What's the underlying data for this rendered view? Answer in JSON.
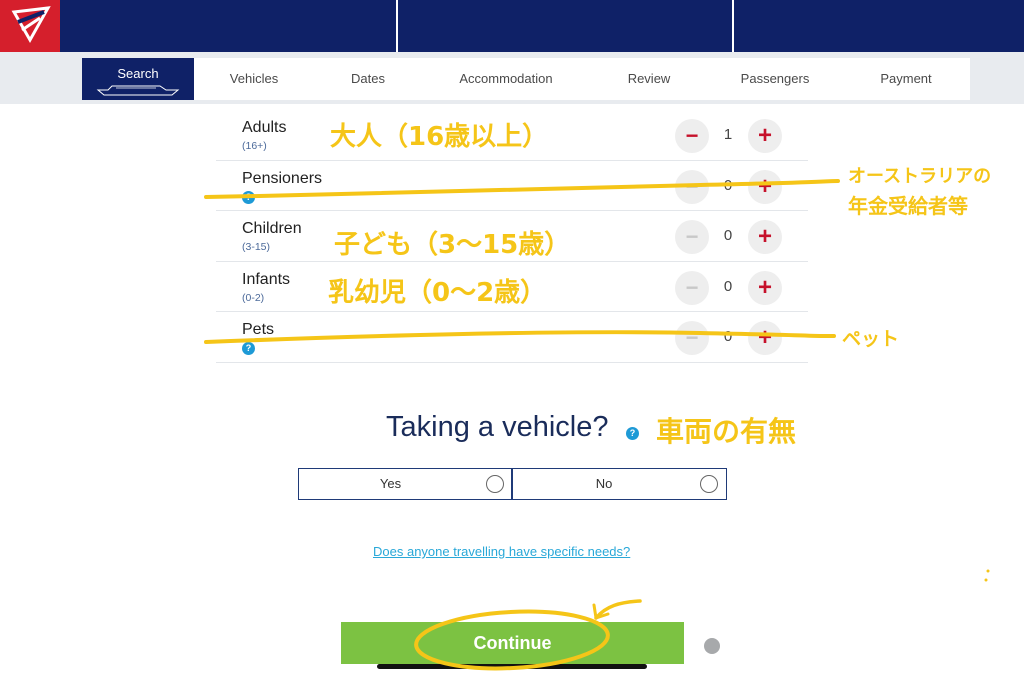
{
  "steps": {
    "search": "Search",
    "vehicles": "Vehicles",
    "dates": "Dates",
    "accommodation": "Accommodation",
    "review": "Review",
    "passengers": "Passengers",
    "payment": "Payment"
  },
  "passengers": {
    "adults": {
      "label": "Adults",
      "sub": "(16+)",
      "count": "1",
      "minus": "−",
      "plus": "+"
    },
    "pensioners": {
      "label": "Pensioners",
      "help": "?",
      "count": "0",
      "minus": "−",
      "plus": "+"
    },
    "children": {
      "label": "Children",
      "sub": "(3-15)",
      "count": "0",
      "minus": "−",
      "plus": "+"
    },
    "infants": {
      "label": "Infants",
      "sub": "(0-2)",
      "count": "0",
      "minus": "−",
      "plus": "+"
    },
    "pets": {
      "label": "Pets",
      "help": "?",
      "count": "0",
      "minus": "−",
      "plus": "+"
    }
  },
  "vehicle": {
    "title": "Taking a vehicle?",
    "help": "?",
    "yes": "Yes",
    "no": "No"
  },
  "needs_link": "Does anyone travelling have specific needs?",
  "continue_label": "Continue",
  "annotations": {
    "adults": "大人（16歳以上）",
    "pensioners_1": "オーストラリアの",
    "pensioners_2": "年金受給者等",
    "children": "子ども（3〜15歳）",
    "infants": "乳幼児（0〜2歳）",
    "pets": "ペット",
    "vehicle": "車両の有無"
  },
  "colors": {
    "navy": "#0f2167",
    "brand_red": "#d51f2c",
    "plus_red": "#c6112b",
    "continue_green": "#7cc242",
    "link_blue": "#29a8d8",
    "annotation_yellow": "#f5c518"
  }
}
